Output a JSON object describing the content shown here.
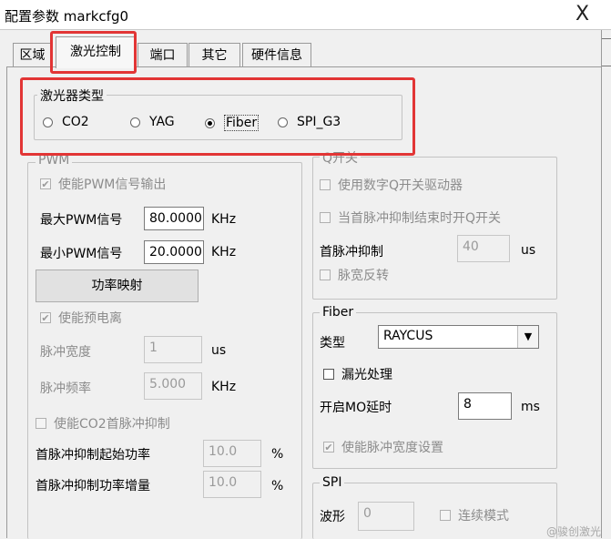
{
  "window": {
    "title": "配置参数 markcfg0",
    "close": "X"
  },
  "tabs": [
    "区域",
    "激光控制",
    "端口",
    "其它",
    "硬件信息"
  ],
  "laser_type": {
    "label": "激光器类型",
    "options": [
      "CO2",
      "YAG",
      "Fiber",
      "SPI_G3"
    ],
    "selected": "Fiber"
  },
  "pwm": {
    "label": "PWM",
    "enable": "使能PWM信号输出",
    "max_label": "最大PWM信号",
    "max_value": "80.0000",
    "max_unit": "KHz",
    "min_label": "最小PWM信号",
    "min_value": "20.0000",
    "min_unit": "KHz",
    "power_map_button": "功率映射",
    "pre_ionize": "使能预电离",
    "pulse_width_label": "脉冲宽度",
    "pulse_width_value": "1",
    "pulse_width_unit": "us",
    "pulse_freq_label": "脉冲频率",
    "pulse_freq_value": "5.000",
    "pulse_freq_unit": "KHz",
    "co2_first_pulse": "使能CO2首脉冲抑制",
    "fp_start_label": "首脉冲抑制起始功率",
    "fp_start_value": "10.0",
    "fp_start_unit": "%",
    "fp_inc_label": "首脉冲抑制功率增量",
    "fp_inc_value": "10.0",
    "fp_inc_unit": "%"
  },
  "qswitch": {
    "label": "Q开关",
    "use_digital": "使用数字Q开关驱动器",
    "open_after": "当首脉冲抑制结束时开Q开关",
    "fp_label": "首脉冲抑制",
    "fp_value": "40",
    "fp_unit": "us",
    "invert": "脉宽反转"
  },
  "fiber": {
    "label": "Fiber",
    "type_label": "类型",
    "type_value": "RAYCUS",
    "leak": "漏光处理",
    "mo_label": "开启MO延时",
    "mo_value": "8",
    "mo_unit": "ms",
    "pw_setting": "使能脉冲宽度设置"
  },
  "spi": {
    "label": "SPI",
    "wave_label": "波形",
    "wave_value": "0",
    "continuous": "连续模式"
  },
  "watermark": "@骏创激光"
}
